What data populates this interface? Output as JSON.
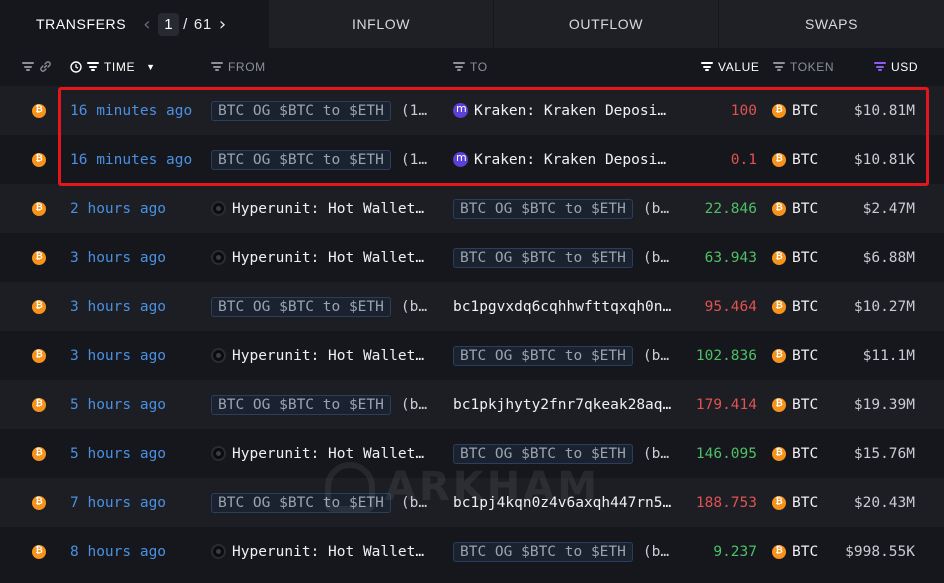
{
  "tabs": {
    "transfers": "TRANSFERS",
    "page_current": "1",
    "page_sep": "/",
    "page_total": "61",
    "inflow": "INFLOW",
    "outflow": "OUTFLOW",
    "swaps": "SWAPS"
  },
  "columns": {
    "time": "TIME",
    "from": "FROM",
    "to": "TO",
    "value": "VALUE",
    "token": "TOKEN",
    "usd": "USD"
  },
  "icons": {
    "filter": "filter-icon",
    "link": "link-icon",
    "clock": "clock-icon",
    "sort": "caret-down-icon",
    "prev": "chevron-left-icon",
    "next": "chevron-right-icon",
    "coin": "bitcoin-icon",
    "hyperunit": "hyperunit-icon",
    "kraken": "kraken-icon"
  },
  "colors": {
    "accent_blue": "#4a90e2",
    "value_red": "#e05252",
    "value_green": "#4fbf67",
    "highlight": "#e3161d",
    "usd_filter": "#8b5cf6"
  },
  "coin_glyph": "₿",
  "rows": [
    {
      "time": "16 minutes ago",
      "from_pill": "BTC OG $BTC to $ETH",
      "from_rest": "(1…",
      "from_entity": "",
      "to_entity": "Kraken: Kraken Deposi…",
      "to_icon": "kraken",
      "to_pill": "",
      "to_rest": "",
      "value": "100",
      "direction": "out",
      "token": "BTC",
      "usd": "$10.81M"
    },
    {
      "time": "16 minutes ago",
      "from_pill": "BTC OG $BTC to $ETH",
      "from_rest": "(1…",
      "from_entity": "",
      "to_entity": "Kraken: Kraken Deposi…",
      "to_icon": "kraken",
      "to_pill": "",
      "to_rest": "",
      "value": "0.1",
      "direction": "out",
      "token": "BTC",
      "usd": "$10.81K"
    },
    {
      "time": "2 hours ago",
      "from_pill": "",
      "from_rest": "",
      "from_entity": "Hyperunit: Hot Wallet…",
      "to_entity": "",
      "to_icon": "",
      "to_pill": "BTC OG $BTC to $ETH",
      "to_rest": "(b…",
      "value": "22.846",
      "direction": "in",
      "token": "BTC",
      "usd": "$2.47M"
    },
    {
      "time": "3 hours ago",
      "from_pill": "",
      "from_rest": "",
      "from_entity": "Hyperunit: Hot Wallet…",
      "to_entity": "",
      "to_icon": "",
      "to_pill": "BTC OG $BTC to $ETH",
      "to_rest": "(b…",
      "value": "63.943",
      "direction": "in",
      "token": "BTC",
      "usd": "$6.88M"
    },
    {
      "time": "3 hours ago",
      "from_pill": "BTC OG $BTC to $ETH",
      "from_rest": "(b…",
      "from_entity": "",
      "to_entity": "bc1pgvxdq6cqhhwfttqxqh0n…",
      "to_icon": "",
      "to_pill": "",
      "to_rest": "",
      "value": "95.464",
      "direction": "out",
      "token": "BTC",
      "usd": "$10.27M"
    },
    {
      "time": "3 hours ago",
      "from_pill": "",
      "from_rest": "",
      "from_entity": "Hyperunit: Hot Wallet…",
      "to_entity": "",
      "to_icon": "",
      "to_pill": "BTC OG $BTC to $ETH",
      "to_rest": "(b…",
      "value": "102.836",
      "direction": "in",
      "token": "BTC",
      "usd": "$11.1M"
    },
    {
      "time": "5 hours ago",
      "from_pill": "BTC OG $BTC to $ETH",
      "from_rest": "(b…",
      "from_entity": "",
      "to_entity": "bc1pkjhyty2fnr7qkeak28aq…",
      "to_icon": "",
      "to_pill": "",
      "to_rest": "",
      "value": "179.414",
      "direction": "out",
      "token": "BTC",
      "usd": "$19.39M"
    },
    {
      "time": "5 hours ago",
      "from_pill": "",
      "from_rest": "",
      "from_entity": "Hyperunit: Hot Wallet…",
      "to_entity": "",
      "to_icon": "",
      "to_pill": "BTC OG $BTC to $ETH",
      "to_rest": "(b…",
      "value": "146.095",
      "direction": "in",
      "token": "BTC",
      "usd": "$15.76M"
    },
    {
      "time": "7 hours ago",
      "from_pill": "BTC OG $BTC to $ETH",
      "from_rest": "(b…",
      "from_entity": "",
      "to_entity": "bc1pj4kqn0z4v6axqh447rn5…",
      "to_icon": "",
      "to_pill": "",
      "to_rest": "",
      "value": "188.753",
      "direction": "out",
      "token": "BTC",
      "usd": "$20.43M"
    },
    {
      "time": "8 hours ago",
      "from_pill": "",
      "from_rest": "",
      "from_entity": "Hyperunit: Hot Wallet…",
      "to_entity": "",
      "to_icon": "",
      "to_pill": "BTC OG $BTC to $ETH",
      "to_rest": "(b…",
      "value": "9.237",
      "direction": "in",
      "token": "BTC",
      "usd": "$998.55K"
    }
  ],
  "watermark": "ARKHAM"
}
